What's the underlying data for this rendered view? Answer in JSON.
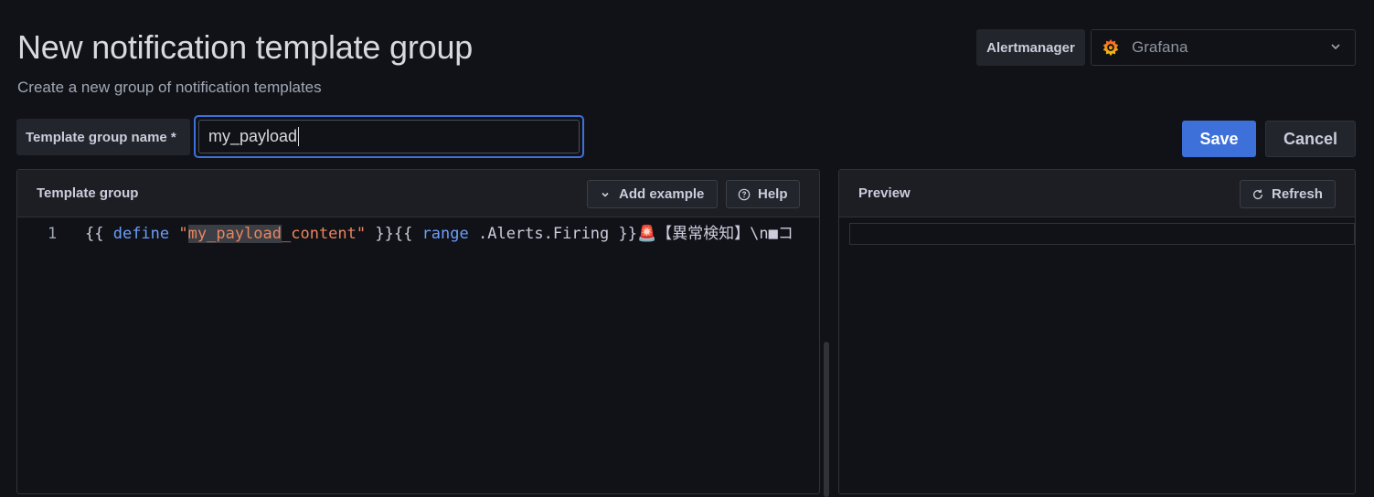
{
  "page": {
    "title": "New notification template group",
    "subtitle": "Create a new group of notification templates"
  },
  "alertmanager": {
    "label": "Alertmanager",
    "selected": "Grafana",
    "icon": "grafana-logo-icon"
  },
  "form": {
    "name_label": "Template group name *",
    "name_value": "my_payload"
  },
  "actions": {
    "save_label": "Save",
    "cancel_label": "Cancel"
  },
  "editor": {
    "title": "Template group",
    "add_example_label": "Add example",
    "help_label": "Help",
    "line_number": "1",
    "code": {
      "open1": "{{ ",
      "define": "define",
      "space1": " ",
      "q1": "\"",
      "name_hl": "my_payload",
      "name_rest": "_content",
      "q2": "\"",
      "close_open": " }}{{ ",
      "range": "range",
      "firing": " .Alerts.Firing }}",
      "emoji": "🚨",
      "tail": "【異常検知】\\n■コ"
    }
  },
  "preview": {
    "title": "Preview",
    "refresh_label": "Refresh"
  },
  "colors": {
    "accent": "#3d71d9",
    "keyword": "#6c9ef8",
    "string": "#e8855f"
  }
}
